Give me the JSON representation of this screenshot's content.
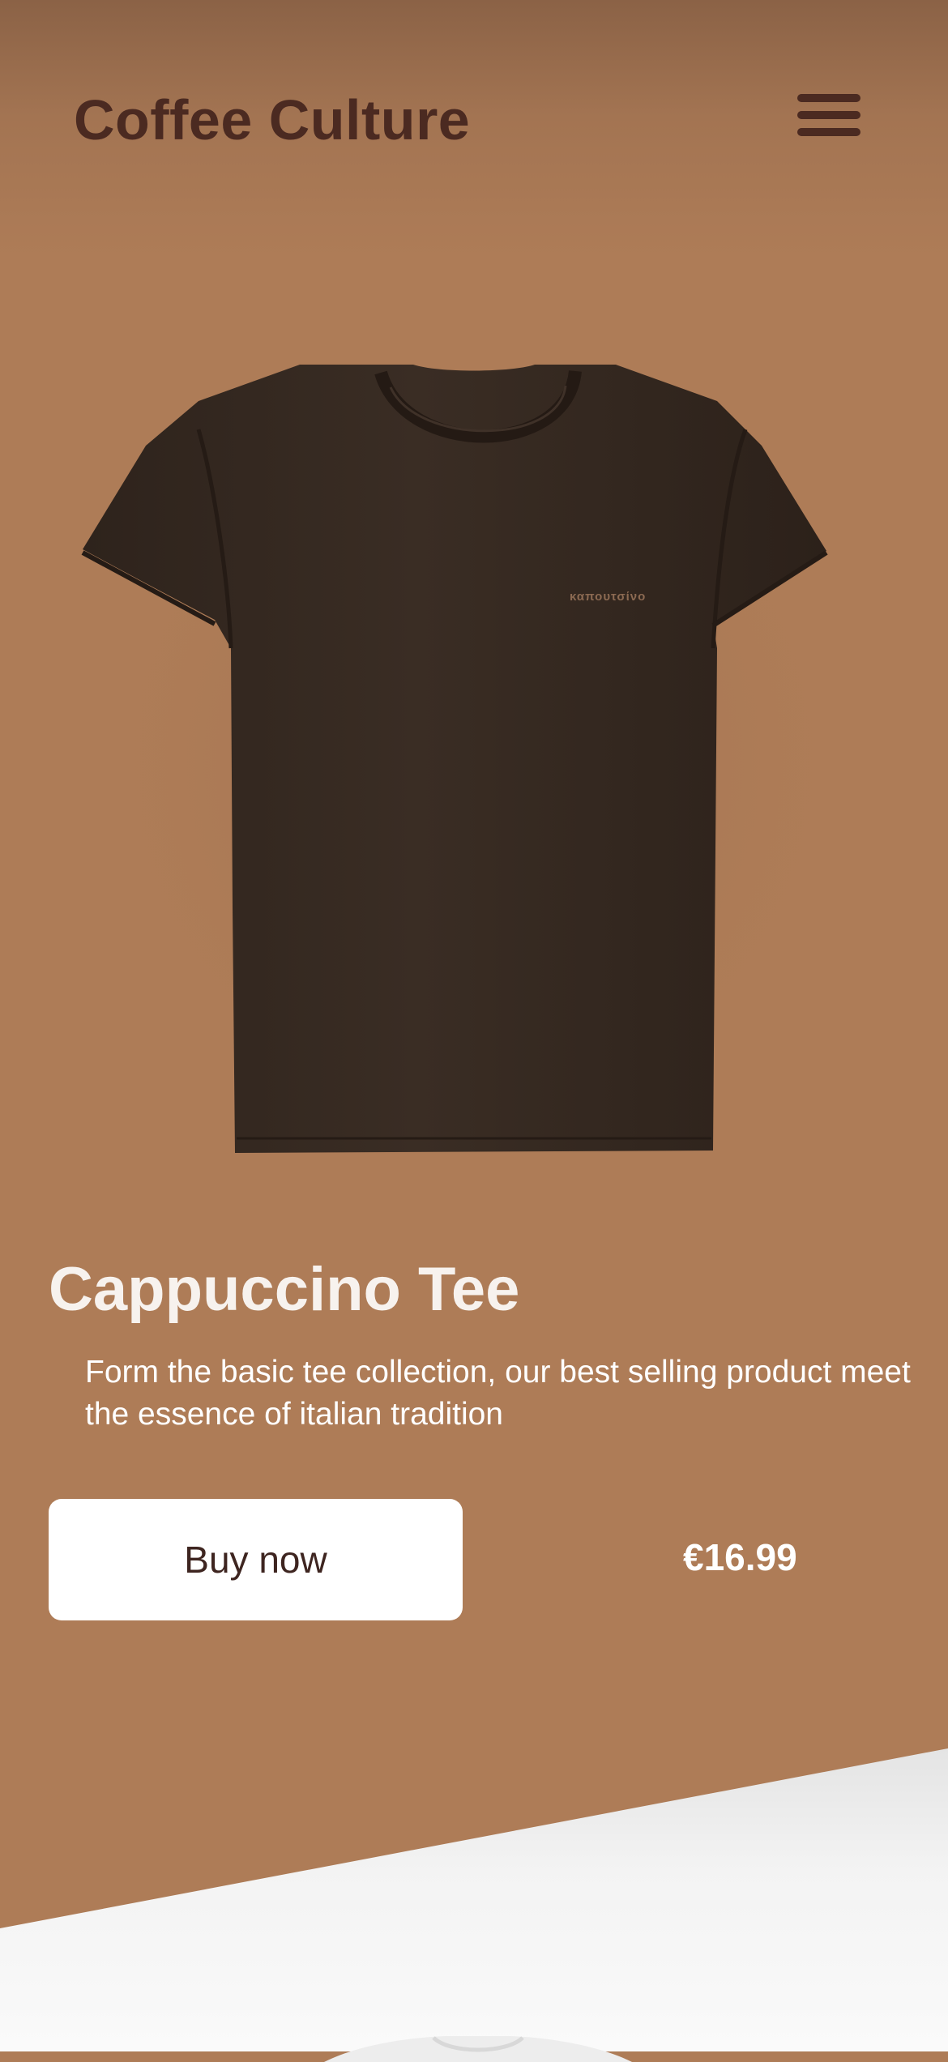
{
  "header": {
    "brand": "Coffee Culture",
    "menu_icon": "hamburger-menu-icon"
  },
  "product": {
    "image_icon": "tshirt-image",
    "shirt_print": "καπουτσίνο",
    "title": "Cappuccino Tee",
    "description": "Form the basic tee collection, our best selling product meet the essence of italian tradition",
    "buy_label": "Buy now",
    "price": "€16.99"
  },
  "colors": {
    "background": "#AE7C57",
    "header_shade": "#8B6246",
    "brand_text": "#4B2A21",
    "shirt": "#342820",
    "title_text": "#F7F2EE",
    "button_bg": "#FFFFFF",
    "button_text": "#3E2520",
    "bottom_panel": "#F2F2F2"
  }
}
